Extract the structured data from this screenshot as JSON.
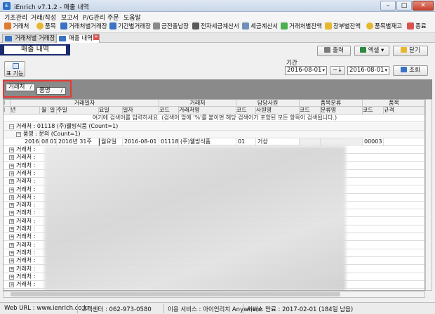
{
  "window": {
    "title": "iEnrich v7.1.2 - 매출 내역"
  },
  "menu": [
    "기초관리",
    "거래/작성",
    "보고서",
    "P/G관리",
    "주문",
    "도움말"
  ],
  "toolbar": [
    "거래처",
    "품목",
    "거래처별거래장",
    "기간별거래장",
    "금전출납장",
    "전자세금계산서",
    "세금계산서",
    "거래처별잔액",
    "장부별잔액",
    "품목별재고",
    "종료"
  ],
  "tabs": [
    {
      "label": "거래처별 거래장"
    },
    {
      "label": "매출 내역"
    }
  ],
  "page_title": "매출 내역",
  "buttons": {
    "print": "출력",
    "excel": "엑셀",
    "close": "닫기",
    "search": "조회",
    "layout": "표 기능"
  },
  "period": {
    "label": "기간",
    "from": "2016-08-01",
    "sep": "~↓",
    "to": "2016-08-01"
  },
  "group_by": [
    {
      "label": "거래처",
      "sort": "/"
    },
    {
      "label": "품명",
      "sort": "/"
    }
  ],
  "grid": {
    "band_headers": [
      "거래일자",
      "거래처",
      "담당사원",
      "품목분류",
      "품목"
    ],
    "columns": [
      "년",
      "월",
      "일",
      "주일",
      "요일",
      "일자",
      "코드",
      "거래처명",
      "코드",
      "사원명",
      "코드",
      "분류명",
      "코드",
      "규격"
    ],
    "filter_hint": "여기에 검색어를 입력하세요. (검색어 앞에 '%'를 붙이면 해당 검색어가 포함된 모든 항목이 검색됩니다.)",
    "group_row": "거래처 : 01118 (주)웰빙식품 (Count=1)",
    "sub_group_row": "품명 : 문의 (Count=1)",
    "data_row": [
      "2016",
      "08",
      "01",
      "2016년 31주",
      "월요일",
      "2016-08-01",
      "01118",
      "(주)웰빙식품",
      "01",
      "거상",
      "",
      "",
      "00003",
      ""
    ],
    "collapsed_group_label": "거래처 : ",
    "collapsed_rows": 18
  },
  "status": {
    "web": "Web URL : www.ienrich.co.kr",
    "center": "고객센터 : 062-973-0580",
    "service": "이용 서비스 : 아이인리치 Anywhere",
    "expiry": "서비스 만료 : 2017-02-01 (184일 남음)"
  }
}
